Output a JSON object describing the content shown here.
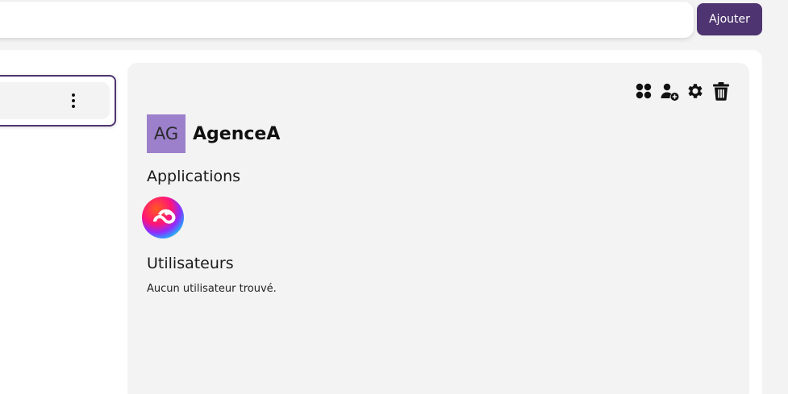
{
  "search": {
    "value": "",
    "placeholder": ""
  },
  "toolbar": {
    "add_label": "Ajouter"
  },
  "agency_list": {
    "items": [
      {
        "name": "",
        "menu_icon": "more-vertical-icon"
      }
    ]
  },
  "detail": {
    "actions": [
      {
        "icon": "apps-grid-icon"
      },
      {
        "icon": "add-user-icon"
      },
      {
        "icon": "gear-icon"
      },
      {
        "icon": "trash-icon"
      }
    ],
    "avatar_initials": "AG",
    "agency_name": "AgenceA",
    "applications_title": "Applications",
    "applications": [
      {
        "icon": "creative-cloud-icon"
      }
    ],
    "users_title": "Utilisateurs",
    "users_empty": "Aucun utilisateur trouvé."
  },
  "colors": {
    "accent": "#4e3470",
    "avatar_bg": "#9c80cc",
    "card_bg": "#f3f3f3",
    "panel_bg": "#ffffff"
  }
}
